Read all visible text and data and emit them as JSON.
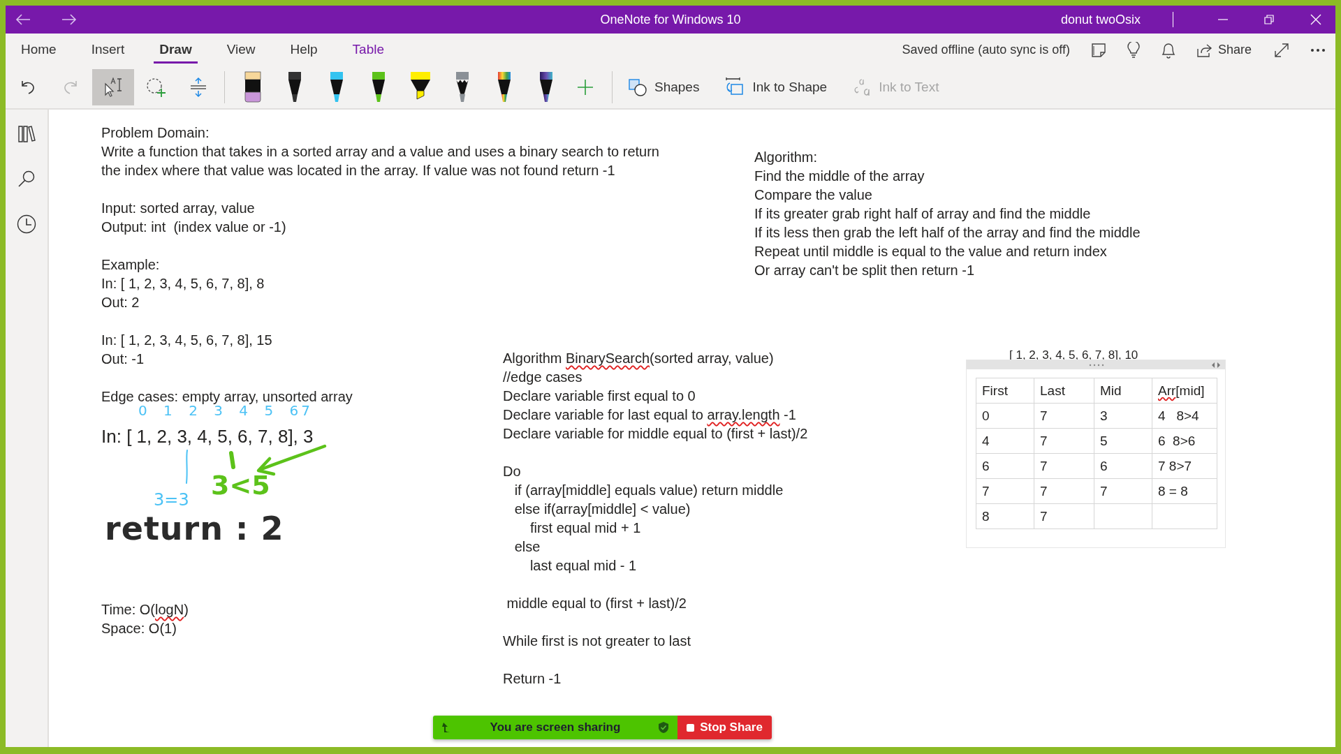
{
  "window": {
    "title": "OneNote for Windows 10",
    "user": "donut twoOsix"
  },
  "tabs": [
    {
      "label": "Home",
      "selected": false,
      "contextual": false
    },
    {
      "label": "Insert",
      "selected": false,
      "contextual": false
    },
    {
      "label": "Draw",
      "selected": true,
      "contextual": false
    },
    {
      "label": "View",
      "selected": false,
      "contextual": false
    },
    {
      "label": "Help",
      "selected": false,
      "contextual": false
    },
    {
      "label": "Table",
      "selected": false,
      "contextual": true
    }
  ],
  "sync_status": "Saved offline (auto sync is off)",
  "share_label": "Share",
  "history": [
    {
      "kind": "undo",
      "disabled": false
    },
    {
      "kind": "redo",
      "disabled": true
    }
  ],
  "modes": [
    {
      "kind": "type-select",
      "selected": true
    },
    {
      "kind": "lasso",
      "selected": false
    },
    {
      "kind": "add-space",
      "selected": false
    }
  ],
  "pens": [
    {
      "kind": "eraser",
      "color": "#c996d9"
    },
    {
      "kind": "pen",
      "color": "#333333"
    },
    {
      "kind": "pen",
      "color": "#33c3f0"
    },
    {
      "kind": "pen",
      "color": "#5cc21a"
    },
    {
      "kind": "highlighter",
      "color": "#ffee00"
    },
    {
      "kind": "pencil",
      "color": "#8a9096"
    },
    {
      "kind": "rainbow"
    },
    {
      "kind": "galaxy"
    }
  ],
  "actions": [
    {
      "kind": "shapes",
      "label": "Shapes",
      "disabled": false
    },
    {
      "kind": "ink-to-shape",
      "label": "Ink to Shape",
      "disabled": false
    },
    {
      "kind": "ink-to-text",
      "label": "Ink to Text",
      "disabled": true
    }
  ],
  "notes": [
    {
      "paragraphs": [
        [
          "Problem Domain:",
          "Write a function that takes in a sorted array and a value and uses a binary search to return",
          "the index where that value was located in the array. If value was not found return -1"
        ],
        [
          "Input: sorted array, value",
          "Output: int  (index value or -1)"
        ],
        [
          "Example:",
          "In: [ 1, 2, 3, 4, 5, 6, 7, 8], 8",
          "Out: 2"
        ],
        [
          "In: [ 1, 2, 3, 4, 5, 6, 7, 8], 15",
          "Out: -1"
        ],
        [
          "Edge cases: empty array, unsorted array"
        ]
      ]
    },
    {
      "paragraphs": [
        [
          "Algorithm:",
          "Find the middle of the array",
          "Compare the value",
          "If its greater grab right half of array and find the middle",
          "If its less then grab the left half of the array and find the middle",
          "Repeat until middle is equal to the value and return index",
          "Or array can't be split then return -1"
        ]
      ]
    },
    {
      "paragraphs": [
        [
          [
            {
              "text": "Algorithm "
            },
            {
              "text": "BinarySearch",
              "misspelled": true
            },
            {
              "text": "(sorted array, value)"
            }
          ],
          "//edge cases",
          "Declare variable first equal to 0",
          [
            {
              "text": "Declare variable for last equal to "
            },
            {
              "text": "array.length",
              "misspelled": true
            },
            {
              "text": " -1"
            }
          ],
          "Declare variable for middle equal to (first + last)/2"
        ],
        [
          "Do",
          "   if (array[middle] equals value) return middle",
          "   else if(array[middle] < value)",
          "       first equal mid + 1",
          "   else",
          "       last equal mid - 1"
        ],
        [
          " middle equal to (first + last)/2"
        ],
        [
          "While first is not greater to last"
        ],
        [
          "Return -1"
        ]
      ]
    },
    {
      "paragraphs": [
        [
          [
            {
              "text": "Time: O("
            },
            {
              "text": "logN",
              "misspelled": true
            },
            {
              "text": ")"
            }
          ],
          "Space: O(1)"
        ]
      ]
    }
  ],
  "example_line": "In: [ 1, 2, 3, 4, 5, 6, 7, 8], 3",
  "ink": [
    {
      "text": "0 1 2 3 4 5 67",
      "color": "#4cc2f5"
    },
    {
      "text": "3=3",
      "color": "#4cc2f5"
    },
    {
      "text": "3<5",
      "color": "#5cc21a"
    },
    {
      "text": "return : 2",
      "color": "#2b2b2b"
    }
  ],
  "table": {
    "caption": "[ 1, 2, 3, 4, 5, 6, 7, 8], 10",
    "columns": [
      "First",
      "Last",
      "Mid",
      [
        {
          "text": "Arr",
          "misspelled": true
        },
        {
          "text": "[mid]"
        }
      ]
    ],
    "rows": [
      [
        "0",
        "7",
        "3",
        "4   8>4"
      ],
      [
        "4",
        "7",
        "5",
        "6  8>6"
      ],
      [
        "6",
        "7",
        "6",
        "7 8>7"
      ],
      [
        "7",
        "7",
        "7",
        "8 = 8"
      ],
      [
        "8",
        "7"
      ]
    ]
  },
  "screen_share": {
    "message": "You are screen sharing",
    "stop_label": "Stop Share"
  }
}
